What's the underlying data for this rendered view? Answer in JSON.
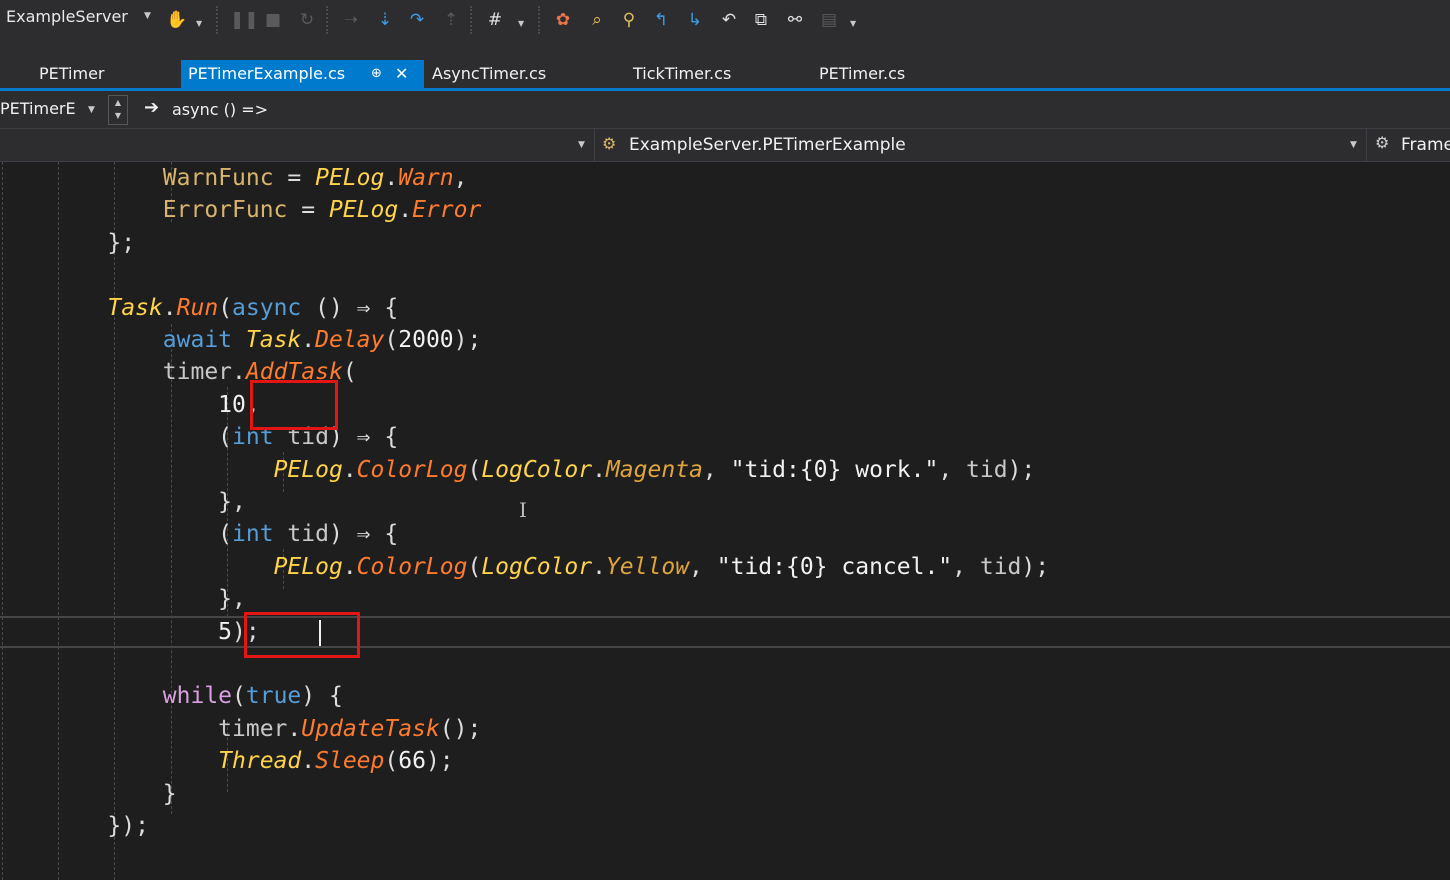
{
  "toolbar": {
    "project": "ExampleServer",
    "icons": [
      "debug-hand-icon",
      "pause-icon",
      "stop-icon",
      "restart-icon",
      "show-next-statement-icon",
      "step-into-icon",
      "step-over-icon",
      "step-out-icon",
      "hex-display-icon",
      "diagnostic-icon",
      "find-icon",
      "find-all-icon",
      "navigate-back-icon",
      "navigate-forward-icon",
      "undo-icon",
      "refresh-icon",
      "link-icon",
      "comment-icon"
    ]
  },
  "tabs": {
    "items": [
      {
        "label": "PETimer",
        "active": false
      },
      {
        "label": "PETimerExample.cs",
        "active": true
      },
      {
        "label": "AsyncTimer.cs",
        "active": false
      },
      {
        "label": "TickTimer.cs",
        "active": false
      },
      {
        "label": "PETimer.cs",
        "active": false
      }
    ],
    "pin_glyph": "⊕",
    "close_glyph": "✕"
  },
  "nav": {
    "scope": "PETimerE",
    "member": "async () =>",
    "type": "ExampleServer.PETimerExample",
    "member_right": "Frame"
  },
  "colors": {
    "accent": "#007acc",
    "background": "#1e1e1e",
    "chrome": "#2d2d30",
    "highlight": "#e41515"
  },
  "code": {
    "lines": [
      [
        {
          "t": "        "
        },
        {
          "t": "WarnFunc",
          "c": "prop"
        },
        {
          "t": " = "
        },
        {
          "t": "PELog",
          "c": "type"
        },
        {
          "t": "."
        },
        {
          "t": "Warn",
          "c": "meth"
        },
        {
          "t": ","
        }
      ],
      [
        {
          "t": "        "
        },
        {
          "t": "ErrorFunc",
          "c": "prop"
        },
        {
          "t": " = "
        },
        {
          "t": "PELog",
          "c": "type"
        },
        {
          "t": "."
        },
        {
          "t": "Error",
          "c": "meth"
        }
      ],
      [
        {
          "t": "    };"
        }
      ],
      [],
      [
        {
          "t": "    "
        },
        {
          "t": "Task",
          "c": "type"
        },
        {
          "t": "."
        },
        {
          "t": "Run",
          "c": "meth"
        },
        {
          "t": "("
        },
        {
          "t": "async",
          "c": "kw"
        },
        {
          "t": " () ⇒ {"
        }
      ],
      [
        {
          "t": "        "
        },
        {
          "t": "await",
          "c": "kw"
        },
        {
          "t": " "
        },
        {
          "t": "Task",
          "c": "type"
        },
        {
          "t": "."
        },
        {
          "t": "Delay",
          "c": "meth"
        },
        {
          "t": "("
        },
        {
          "t": "2000",
          "c": "num"
        },
        {
          "t": ");"
        }
      ],
      [
        {
          "t": "        "
        },
        {
          "t": "timer",
          "c": "var"
        },
        {
          "t": "."
        },
        {
          "t": "AddTask",
          "c": "meth"
        },
        {
          "t": "("
        }
      ],
      [
        {
          "t": "            "
        },
        {
          "t": "10",
          "c": "num"
        },
        {
          "t": ","
        }
      ],
      [
        {
          "t": "            ("
        },
        {
          "t": "int",
          "c": "kw"
        },
        {
          "t": " "
        },
        {
          "t": "tid",
          "c": "var"
        },
        {
          "t": ") ⇒ {"
        }
      ],
      [
        {
          "t": "                "
        },
        {
          "t": "PELog",
          "c": "type"
        },
        {
          "t": "."
        },
        {
          "t": "ColorLog",
          "c": "meth"
        },
        {
          "t": "("
        },
        {
          "t": "LogColor",
          "c": "type"
        },
        {
          "t": "."
        },
        {
          "t": "Magenta",
          "c": "field"
        },
        {
          "t": ", "
        },
        {
          "t": "\"tid:{0} work.\"",
          "c": "str"
        },
        {
          "t": ", "
        },
        {
          "t": "tid",
          "c": "var"
        },
        {
          "t": ");"
        }
      ],
      [
        {
          "t": "            },"
        }
      ],
      [
        {
          "t": "            ("
        },
        {
          "t": "int",
          "c": "kw"
        },
        {
          "t": " "
        },
        {
          "t": "tid",
          "c": "var"
        },
        {
          "t": ") ⇒ {"
        }
      ],
      [
        {
          "t": "                "
        },
        {
          "t": "PELog",
          "c": "type"
        },
        {
          "t": "."
        },
        {
          "t": "ColorLog",
          "c": "meth"
        },
        {
          "t": "("
        },
        {
          "t": "LogColor",
          "c": "type"
        },
        {
          "t": "."
        },
        {
          "t": "Yellow",
          "c": "field"
        },
        {
          "t": ", "
        },
        {
          "t": "\"tid:{0} cancel.\"",
          "c": "str"
        },
        {
          "t": ", "
        },
        {
          "t": "tid",
          "c": "var"
        },
        {
          "t": ");"
        }
      ],
      [
        {
          "t": "            },"
        }
      ],
      [
        {
          "t": "            "
        },
        {
          "t": "5",
          "c": "num"
        },
        {
          "t": ");"
        }
      ],
      [],
      [
        {
          "t": "        "
        },
        {
          "t": "while",
          "c": "ctrl"
        },
        {
          "t": "("
        },
        {
          "t": "true",
          "c": "kw"
        },
        {
          "t": ") {"
        }
      ],
      [
        {
          "t": "            "
        },
        {
          "t": "timer",
          "c": "var"
        },
        {
          "t": "."
        },
        {
          "t": "UpdateTask",
          "c": "meth"
        },
        {
          "t": "();"
        }
      ],
      [
        {
          "t": "            "
        },
        {
          "t": "Thread",
          "c": "type"
        },
        {
          "t": "."
        },
        {
          "t": "Sleep",
          "c": "meth"
        },
        {
          "t": "("
        },
        {
          "t": "66",
          "c": "num"
        },
        {
          "t": ");"
        }
      ],
      [
        {
          "t": "        }"
        }
      ],
      [
        {
          "t": "    });"
        }
      ]
    ]
  }
}
